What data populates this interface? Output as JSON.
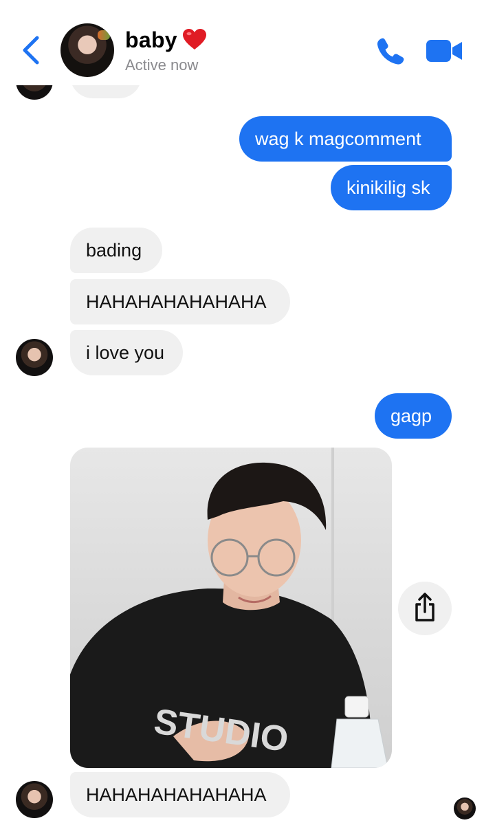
{
  "header": {
    "title": "baby",
    "status": "Active now",
    "back_icon": "chevron-left-icon",
    "heart_icon": "red-heart-icon",
    "call_icon": "phone-icon",
    "video_icon": "video-camera-icon",
    "accent_color": "#1e73f2"
  },
  "messages": {
    "m1": "wag k magcomment",
    "m2": "kinikilig sk",
    "m3": "bading",
    "m4": "HAHAHAHAHAHAHA",
    "m5": "i love you",
    "m6": "gagp",
    "m7": "HAHAHAHAHAHAHA"
  },
  "photo_shirt_text": "STUDIO",
  "share_icon": "share-icon",
  "colors": {
    "outgoing_bubble": "#1e73f2",
    "incoming_bubble": "#f0f0f0",
    "status_text": "#8a8a8e"
  }
}
